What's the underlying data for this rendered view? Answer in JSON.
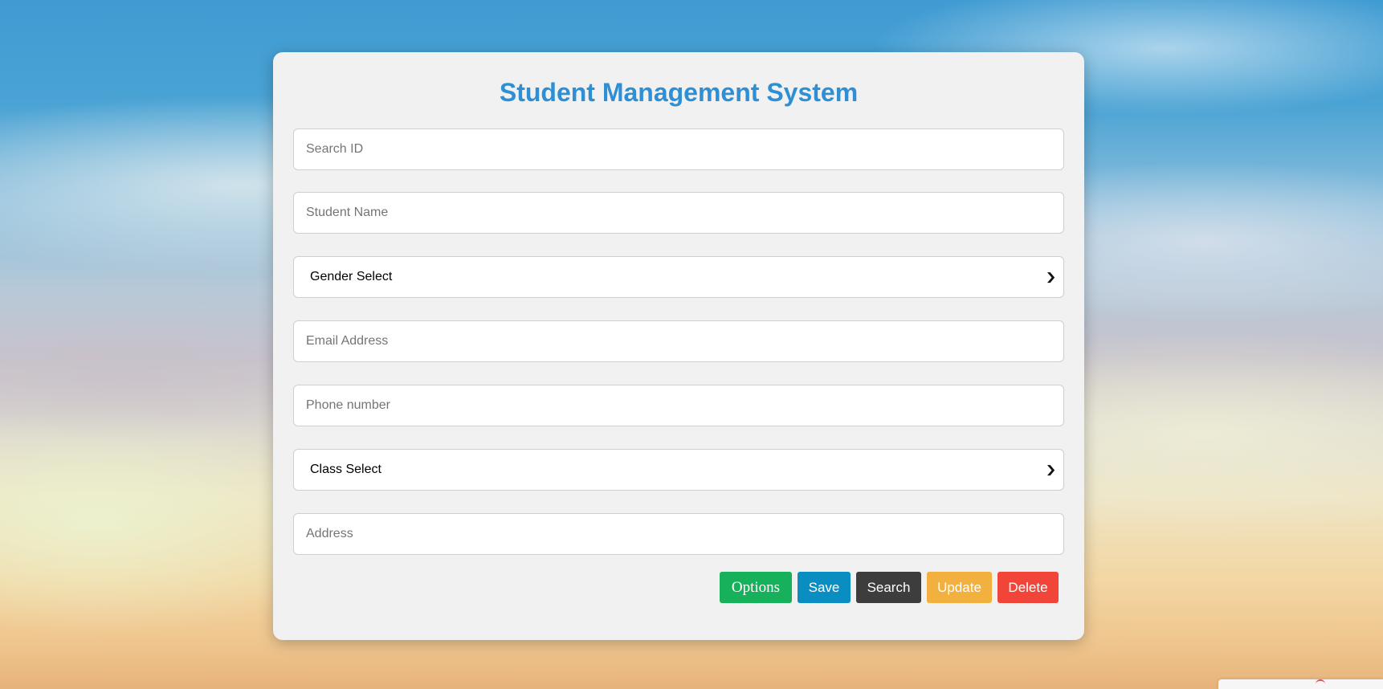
{
  "form": {
    "title": "Student Management System",
    "search_id": {
      "placeholder": "Search ID",
      "value": ""
    },
    "student_name": {
      "placeholder": "Student Name",
      "value": ""
    },
    "gender": {
      "selected": "Gender Select"
    },
    "email": {
      "placeholder": "Email Address",
      "value": ""
    },
    "phone": {
      "placeholder": "Phone number",
      "value": ""
    },
    "class": {
      "selected": "Class Select"
    },
    "address": {
      "placeholder": "Address",
      "value": ""
    }
  },
  "actions": {
    "options_label": "Options",
    "save_label": "Save",
    "search_label": "Search",
    "update_label": "Update",
    "delete_label": "Delete"
  },
  "colors": {
    "title": "#2f8fd4",
    "options": "#17b15c",
    "save": "#0a8ec2",
    "search": "#3d3d3d",
    "update": "#f2b13f",
    "delete": "#f2453a"
  },
  "icons": {
    "select_chevron": "chevron-down-icon"
  }
}
